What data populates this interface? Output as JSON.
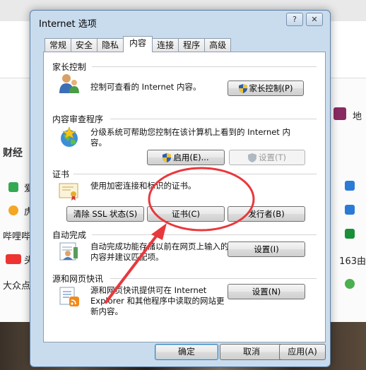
{
  "background": {
    "left_items": [
      "财经",
      "爱",
      "虎",
      "哔哩哔",
      "头",
      "大众点"
    ],
    "right_items": [
      "地",
      "163由"
    ]
  },
  "dialog": {
    "title": "Internet 选项",
    "title_buttons": [
      "?",
      "✕"
    ],
    "tabs": [
      "常规",
      "安全",
      "隐私",
      "内容",
      "连接",
      "程序",
      "高级"
    ],
    "active_tab": "内容"
  },
  "parental": {
    "title": "家长控制",
    "desc": "控制可查看的 Internet 内容。",
    "button": "家长控制(P)"
  },
  "advisor": {
    "title": "内容审查程序",
    "desc": "分级系统可帮助您控制在该计算机上看到的 Internet 内容。",
    "enable_button": "启用(E)...",
    "settings_button": "设置(T)"
  },
  "certificates": {
    "title": "证书",
    "desc": "使用加密连接和标识的证书。",
    "clear_ssl_button": "清除 SSL 状态(S)",
    "certs_button": "证书(C)",
    "publishers_button": "发行者(B)"
  },
  "autocomplete": {
    "title": "自动完成",
    "desc": "自动完成功能存储以前在网页上输入的内容并建议匹配项。",
    "settings_button": "设置(I)"
  },
  "feeds": {
    "title": "源和网页快讯",
    "desc": "源和网页快讯提供可在 Internet Explorer 和其他程序中读取的网站更新内容。",
    "settings_button": "设置(N)"
  },
  "footer": {
    "ok": "确定",
    "cancel": "取消",
    "apply": "应用(A)"
  },
  "colors": {
    "frame": "#c9dcee",
    "annotation": "#e8383d"
  }
}
